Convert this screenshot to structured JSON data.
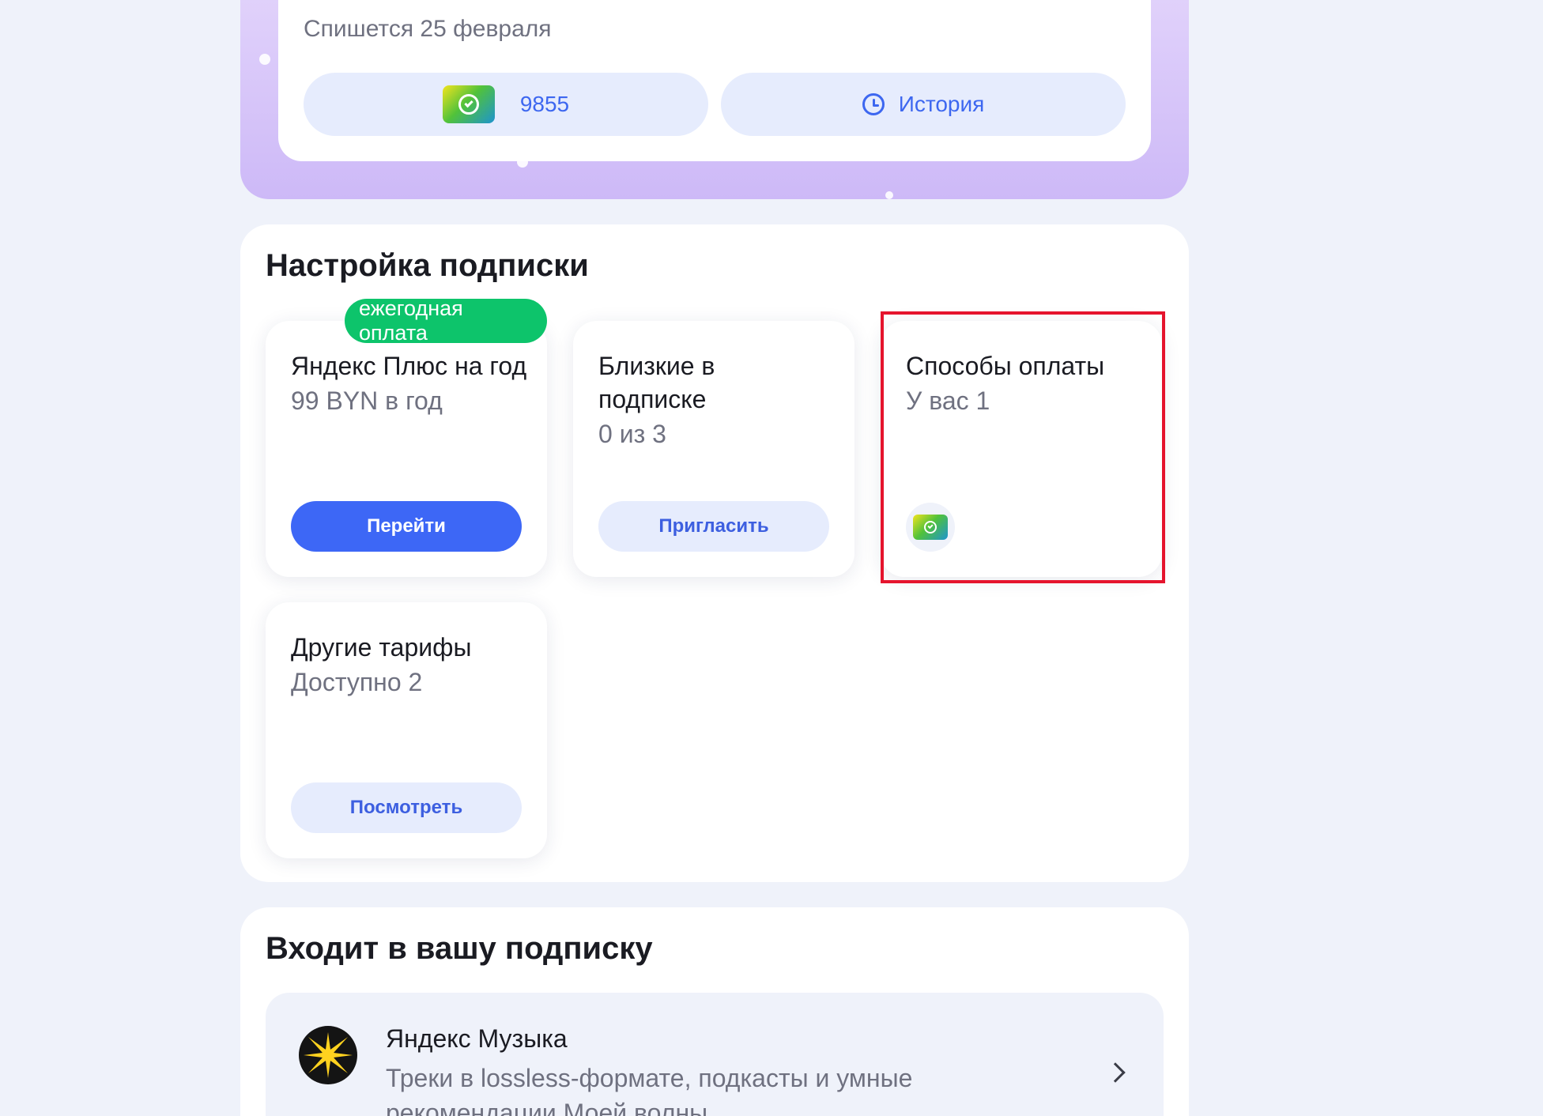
{
  "subscription_card": {
    "charge_text": "Спишется 25 февраля",
    "card_button_label": "9855",
    "card_icon": "bank-card-icon",
    "history_button_label": "История",
    "history_icon": "clock-icon"
  },
  "settings": {
    "title": "Настройка подписки",
    "tiles": [
      {
        "badge": "ежегодная оплата",
        "title": "Яндекс Плюс на год",
        "subtitle": "99 BYN в год",
        "button_label": "Перейти"
      },
      {
        "title": "Близкие в подписке",
        "subtitle": "0 из 3",
        "button_label": "Пригласить"
      },
      {
        "title": "Способы оплаты",
        "subtitle": "У вас 1",
        "icon": "bank-card-icon"
      },
      {
        "title": "Другие тарифы",
        "subtitle": "Доступно 2",
        "button_label": "Посмотреть"
      }
    ]
  },
  "included": {
    "title": "Входит в вашу подписку",
    "services": [
      {
        "name": "Яндекс Музыка",
        "description": "Треки в lossless-формате, подкасты и умные рекомендации Моей волны",
        "icon": "yandex-music-icon"
      }
    ]
  },
  "colors": {
    "accent": "#3d67f6",
    "badge_green": "#0dc46b",
    "highlight_red": "#e5142d",
    "page_bg": "#eff2fa"
  }
}
